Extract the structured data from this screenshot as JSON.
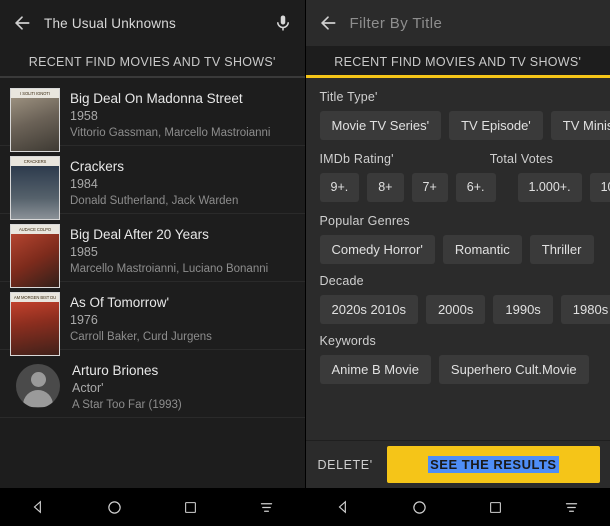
{
  "left": {
    "back_icon": "arrow-left-icon",
    "search_value": "The Usual Unknowns",
    "mic_icon": "microphone-icon",
    "tab_label": "RECENT FIND MOVIES AND TV SHOWS'",
    "results": [
      {
        "poster_text": "I SOLITI IGNOTI",
        "title": "Big Deal On Madonna Street",
        "year": "1958",
        "cast": "Vittorio Gassman, Marcello Mastroianni"
      },
      {
        "poster_text": "CRACKERS",
        "title": "Crackers",
        "year": "1984",
        "cast": "Donald Sutherland, Jack Warden"
      },
      {
        "poster_text": "AUDACE COLPO",
        "title": "Big Deal After 20 Years",
        "year": "1985",
        "cast": "Marcello Mastroianni, Luciano Bonanni"
      },
      {
        "poster_text": "AM MORGEN BIST DU TOT",
        "title": "As Of Tomorrow'",
        "year": "1976",
        "cast": "Carroll Baker, Curd Jurgens"
      },
      {
        "poster_text": "",
        "title": "Arturo Briones",
        "year": "Actor'",
        "cast": "A Star Too Far (1993)"
      }
    ]
  },
  "right": {
    "back_icon": "arrow-left-icon",
    "filter_placeholder": "Filter By Title",
    "tab_label": "RECENT FIND MOVIES AND TV SHOWS'",
    "sections": [
      {
        "label": "Title Type'",
        "chips": [
          "Movie TV Series'",
          "TV Episode'",
          "TV Miniseries"
        ]
      },
      {
        "label": "IMDb Rating'",
        "label2": "Total Votes",
        "chips": [
          "9+.",
          "8+",
          "7+",
          "6+."
        ],
        "chips2": [
          "1.000+.",
          "10"
        ]
      },
      {
        "label": "Popular Genres",
        "chips": [
          "Comedy Horror'",
          "Romantic",
          "Thriller"
        ]
      },
      {
        "label": "Decade",
        "chips": [
          "2020s 2010s",
          "2000s",
          "1990s",
          "1980s"
        ]
      },
      {
        "label": "Keywords",
        "chips": [
          "Anime B Movie",
          "Superhero Cult.Movie"
        ]
      }
    ],
    "delete_label": "DELETE'",
    "see_results_label": "SEE THE RESULTS"
  },
  "navbar": {
    "back_icon": "triangle-back-icon",
    "home_icon": "circle-home-icon",
    "recents_icon": "square-recents-icon",
    "menu_icon": "hamburger-menu-icon"
  },
  "colors": {
    "accent": "#f5c518",
    "selection": "#4f8ef7",
    "left_bg": "#1d1d1d",
    "right_bg": "#2b2b2b",
    "chip_bg": "#3a3a3a"
  }
}
